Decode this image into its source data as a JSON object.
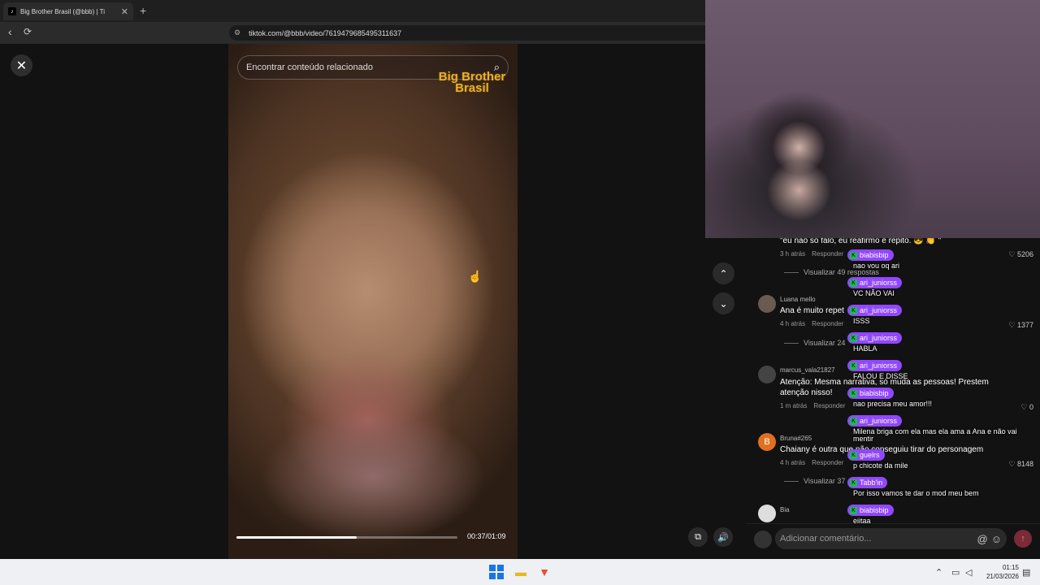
{
  "browser": {
    "tab_title": "Big Brother Brasil (@bbb) | Ti",
    "tab_close": "✕",
    "new_tab": "+",
    "url": "tiktok.com/@bbb/video/7619479685495311637",
    "back_icon": "‹",
    "reload_icon": "⟳",
    "site_info_icon": "⚙"
  },
  "video": {
    "search_placeholder": "Encontrar conteúdo relacionado",
    "watermark_line1": "Big Brother",
    "watermark_line2": "Brasil",
    "timecode": "00:37/01:09",
    "progress": 0.545
  },
  "icons": {
    "close": "✕",
    "search": "⌕",
    "up": "⌃",
    "down": "⌄",
    "pip": "⧉",
    "volume": "🔊",
    "cursor": "☝",
    "mention": "@",
    "emoji": "☺",
    "send": "↑",
    "heart": "♡"
  },
  "comments": [
    {
      "user": "",
      "text": "\"eu não só falo, eu reafirmo e repito. 😎 👏 \"",
      "time": "3 h atrás",
      "reply": "Responder",
      "likes": "5206",
      "replies": "Visualizar 49 respostas"
    },
    {
      "user": "Luana mello",
      "text": "Ana é muito repet",
      "time": "4 h atrás",
      "reply": "Responder",
      "likes": "1377",
      "replies": "Visualizar 24"
    },
    {
      "user": "marcus_vala21827",
      "text": "Atenção: Mesma narrativa, só muda as pessoas! Prestem atenção nisso!",
      "time": "1 m atrás",
      "reply": "Responder",
      "likes": "0",
      "replies": ""
    },
    {
      "user": "Bruna#265",
      "avatar_letter": "B",
      "text": "Chaiany é outra que não conseguiu tirar do personagem",
      "time": "4 h atrás",
      "reply": "Responder",
      "likes": "8148",
      "replies": "Visualizar 37"
    },
    {
      "user": "Bia",
      "text": "",
      "time": "",
      "reply": "",
      "likes": "",
      "replies": ""
    }
  ],
  "add_comment_placeholder": "Adicionar comentário...",
  "chat": [
    {
      "name": "biabisbip",
      "text": "nao vou oq ari"
    },
    {
      "name": "ari_juniorss",
      "text": "VC NÃO VAI"
    },
    {
      "name": "ari_juniorss",
      "text": "ISSS"
    },
    {
      "name": "ari_juniorss",
      "text": "HABLA"
    },
    {
      "name": "ari_juniorss",
      "text": "FALOU E DISSE"
    },
    {
      "name": "biabisbip",
      "text": "nao precisa meu amor!!!"
    },
    {
      "name": "ari_juniorss",
      "text": "Milena briga com ela mas ela ama a Ana e não vai mentir"
    },
    {
      "name": "guelrs",
      "text": "p chicote da mile"
    },
    {
      "name": "Tabb'in",
      "text": "Por isso vamos te dar o mod meu bem"
    },
    {
      "name": "biabisbip",
      "text": "eiitaa"
    }
  ],
  "taskbar": {
    "time": "01:15",
    "date": "21/03/2026",
    "tray_chevron": "⌃",
    "tray_network": "▭",
    "tray_volume": "◁",
    "tray_notify": "▤"
  }
}
